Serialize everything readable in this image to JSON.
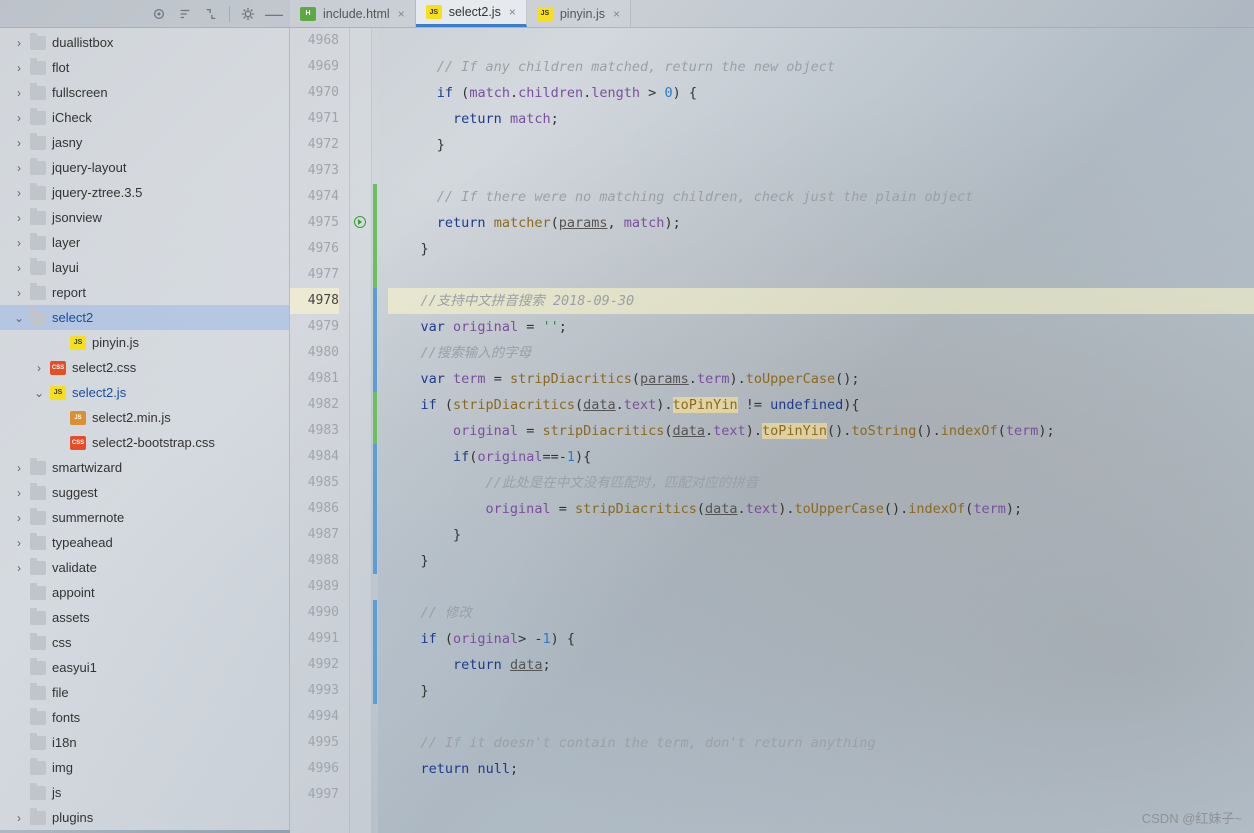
{
  "toolbar": {
    "icons": [
      "target",
      "sort",
      "expand",
      "divider",
      "gear",
      "minimize"
    ]
  },
  "tabs": [
    {
      "label": "include.html",
      "icon": "html",
      "active": false
    },
    {
      "label": "select2.js",
      "icon": "js",
      "active": true
    },
    {
      "label": "pinyin.js",
      "icon": "js",
      "active": false
    }
  ],
  "sidebar": {
    "items": [
      {
        "label": "duallistbox",
        "type": "folder",
        "depth": 1,
        "arrow": ">"
      },
      {
        "label": "flot",
        "type": "folder",
        "depth": 1,
        "arrow": ">"
      },
      {
        "label": "fullscreen",
        "type": "folder",
        "depth": 1,
        "arrow": ">"
      },
      {
        "label": "iCheck",
        "type": "folder",
        "depth": 1,
        "arrow": ">"
      },
      {
        "label": "jasny",
        "type": "folder",
        "depth": 1,
        "arrow": ">"
      },
      {
        "label": "jquery-layout",
        "type": "folder",
        "depth": 1,
        "arrow": ">"
      },
      {
        "label": "jquery-ztree.3.5",
        "type": "folder",
        "depth": 1,
        "arrow": ">"
      },
      {
        "label": "jsonview",
        "type": "folder",
        "depth": 1,
        "arrow": ">"
      },
      {
        "label": "layer",
        "type": "folder",
        "depth": 1,
        "arrow": ">"
      },
      {
        "label": "layui",
        "type": "folder",
        "depth": 1,
        "arrow": ">"
      },
      {
        "label": "report",
        "type": "folder",
        "depth": 1,
        "arrow": ">"
      },
      {
        "label": "select2",
        "type": "folder",
        "depth": 1,
        "arrow": "v",
        "selected": true
      },
      {
        "label": "pinyin.js",
        "type": "js",
        "depth": 3,
        "arrow": ""
      },
      {
        "label": "select2.css",
        "type": "css",
        "depth": 2,
        "arrow": ">"
      },
      {
        "label": "select2.js",
        "type": "js",
        "depth": 2,
        "arrow": "v",
        "activeFile": true
      },
      {
        "label": "select2.min.js",
        "type": "minjs",
        "depth": 3,
        "arrow": ""
      },
      {
        "label": "select2-bootstrap.css",
        "type": "css",
        "depth": 3,
        "arrow": ""
      },
      {
        "label": "smartwizard",
        "type": "folder",
        "depth": 1,
        "arrow": ">"
      },
      {
        "label": "suggest",
        "type": "folder",
        "depth": 1,
        "arrow": ">"
      },
      {
        "label": "summernote",
        "type": "folder",
        "depth": 1,
        "arrow": ">"
      },
      {
        "label": "typeahead",
        "type": "folder",
        "depth": 1,
        "arrow": ">"
      },
      {
        "label": "validate",
        "type": "folder",
        "depth": 1,
        "arrow": ">"
      },
      {
        "label": "appoint",
        "type": "folder",
        "depth": 1,
        "arrow": ""
      },
      {
        "label": "assets",
        "type": "folder",
        "depth": 1,
        "arrow": ""
      },
      {
        "label": "css",
        "type": "folder",
        "depth": 1,
        "arrow": ""
      },
      {
        "label": "easyui1",
        "type": "folder",
        "depth": 1,
        "arrow": ""
      },
      {
        "label": "file",
        "type": "folder",
        "depth": 1,
        "arrow": ""
      },
      {
        "label": "fonts",
        "type": "folder",
        "depth": 1,
        "arrow": ""
      },
      {
        "label": "i18n",
        "type": "folder",
        "depth": 1,
        "arrow": ""
      },
      {
        "label": "img",
        "type": "folder",
        "depth": 1,
        "arrow": ""
      },
      {
        "label": "js",
        "type": "folder",
        "depth": 1,
        "arrow": ""
      },
      {
        "label": "plugins",
        "type": "folder",
        "depth": 1,
        "arrow": ">"
      }
    ]
  },
  "editor": {
    "lineStart": 4968,
    "highlightLine": 4978,
    "gutterRunIcon": 4975,
    "lines": {
      "4968": "",
      "4969": "      // If any children matched, return the new object",
      "4970": "      if (match.children.length > 0) {",
      "4971": "        return match;",
      "4972": "      }",
      "4973": "",
      "4974": "      // If there were no matching children, check just the plain object",
      "4975": "      return matcher(params, match);",
      "4976": "    }",
      "4977": "",
      "4978": "    //支持中文拼音搜索 2018-09-30",
      "4979": "    var original = '';",
      "4980": "    //搜索输入的字母",
      "4981": "    var term = stripDiacritics(params.term).toUpperCase();",
      "4982": "    if (stripDiacritics(data.text).toPinYin != undefined){",
      "4983": "        original = stripDiacritics(data.text).toPinYin().toString().indexOf(term);",
      "4984": "        if(original==-1){",
      "4985": "            //此处是在中文没有匹配时，匹配对应的拼音",
      "4986": "            original = stripDiacritics(data.text).toUpperCase().indexOf(term);",
      "4987": "        }",
      "4988": "    }",
      "4989": "",
      "4990": "    // 修改",
      "4991": "    if (original> -1) {",
      "4992": "        return data;",
      "4993": "    }",
      "4994": "",
      "4995": "    // If it doesn't contain the term, don't return anything",
      "4996": "    return null;",
      "4997": ""
    }
  },
  "watermark": "CSDN @红妹子~"
}
